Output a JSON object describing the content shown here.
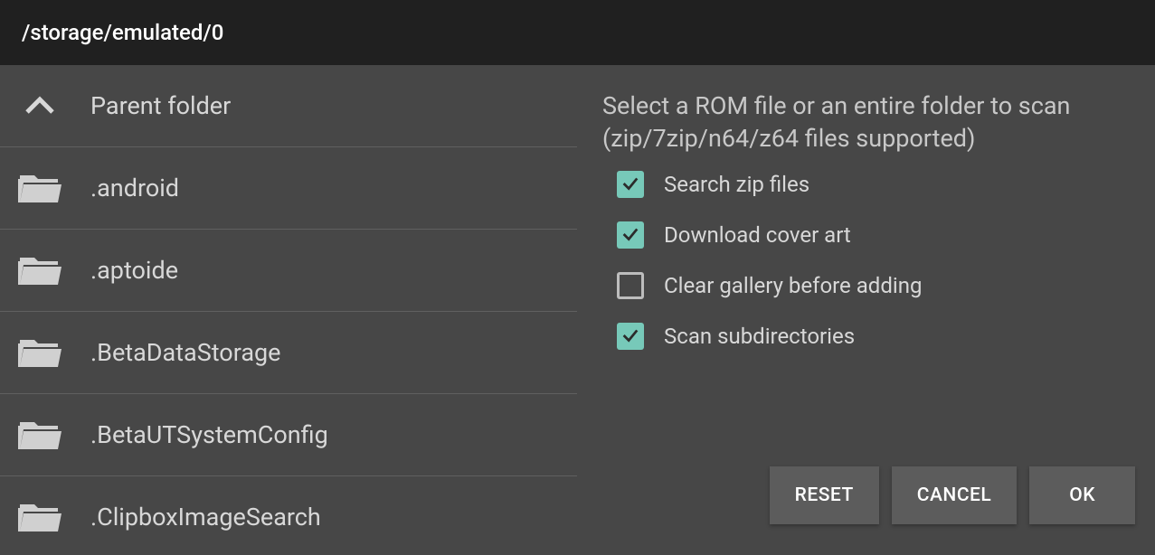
{
  "header": {
    "path": "/storage/emulated/0"
  },
  "file_list": {
    "parent_label": "Parent folder",
    "items": [
      {
        "name": ".android"
      },
      {
        "name": ".aptoide"
      },
      {
        "name": ".BetaDataStorage"
      },
      {
        "name": ".BetaUTSystemConfig"
      },
      {
        "name": ".ClipboxImageSearch"
      }
    ]
  },
  "panel": {
    "instruction": "Select a ROM file or an entire folder to scan (zip/7zip/n64/z64 files supported)",
    "options": [
      {
        "label": "Search zip files",
        "checked": true
      },
      {
        "label": "Download cover art",
        "checked": true
      },
      {
        "label": "Clear gallery before adding",
        "checked": false
      },
      {
        "label": "Scan subdirectories",
        "checked": true
      }
    ]
  },
  "buttons": {
    "reset": "RESET",
    "cancel": "CANCEL",
    "ok": "OK"
  },
  "colors": {
    "accent": "#77c9b9"
  }
}
